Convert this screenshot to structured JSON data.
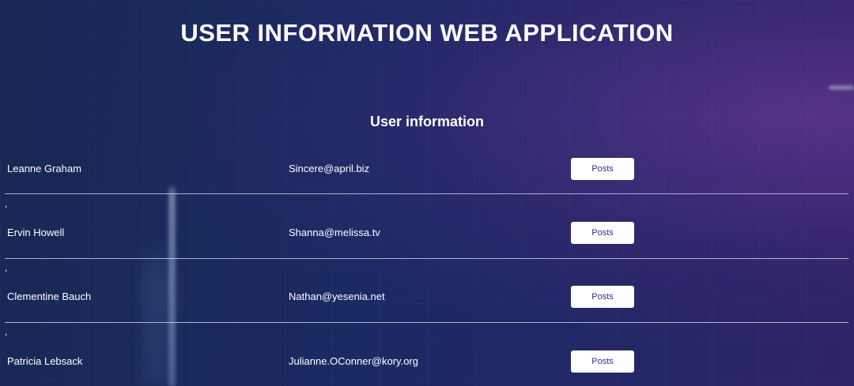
{
  "header": {
    "title": "USER INFORMATION WEB APPLICATION"
  },
  "section": {
    "heading": "User information"
  },
  "users": [
    {
      "name": "Leanne Graham",
      "email": "Sincere@april.biz",
      "button_label": "Posts"
    },
    {
      "name": "Ervin Howell",
      "email": "Shanna@melissa.tv",
      "button_label": "Posts"
    },
    {
      "name": "Clementine Bauch",
      "email": "Nathan@yesenia.net",
      "button_label": "Posts"
    },
    {
      "name": "Patricia Lebsack",
      "email": "Julianne.OConner@kory.org",
      "button_label": "Posts"
    }
  ],
  "separator_text": ",",
  "colors": {
    "background_start": "#182955",
    "background_end": "#2e2466",
    "text": "#ffffff",
    "button_background": "#ffffff",
    "button_text": "#2b2f9a",
    "divider": "#dce1f0"
  }
}
